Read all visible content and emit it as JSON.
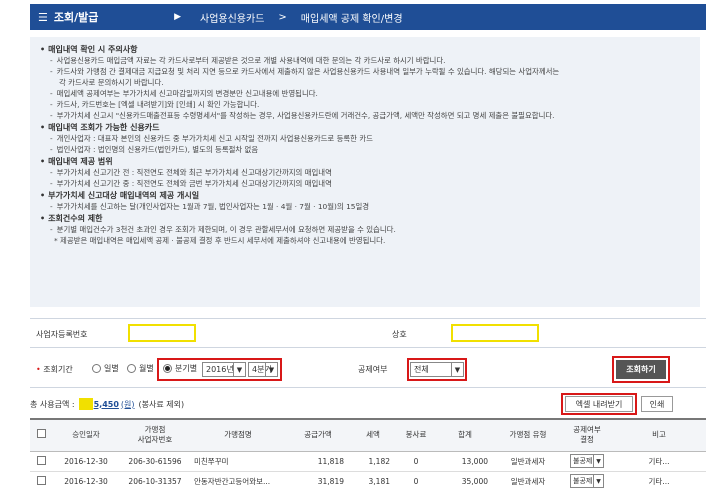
{
  "header": {
    "menu_title": "조회/발급",
    "crumbs": [
      "사업용신용카드",
      "매입세액 공제 확인/변경"
    ]
  },
  "notice": {
    "sections": [
      {
        "title": "매입내역 확인 시 주의사항",
        "items": [
          {
            "type": "it",
            "text": "사업용신용카드 매입금액 자료는 각 카드사로부터 제공받은 것으로 개별 사용내역에 대한 문의는 각 카드사로 하시기 바랍니다."
          },
          {
            "type": "it",
            "text": "카드사와 가맹점 간 결제대금 지급요청 및 처리 지연 등으로 카드사에서 제출하지 않은 사업용신용카드 사용내역 일부가 누락될 수 있습니다. 해당되는 사업자께서는"
          },
          {
            "type": "cont",
            "text": "각 카드사로 문의하시기 바랍니다."
          },
          {
            "type": "it",
            "text": "매입세액 공제여부는 부가가치세 신고마감일까지의 변경분만 신고내용에 반영됩니다."
          },
          {
            "type": "it",
            "text": "카드사, 카드번호는 [엑셀 내려받기]와 [인쇄] 시 확인 가능합니다."
          },
          {
            "type": "it",
            "text": "부가가치세 신고시 \"신용카드매출전표등 수령명세서\"를 작성하는 경우, 사업용신용카드란에 거래건수, 공급가액, 세액만 작성하면 되고 명세 제출은 불필요합니다."
          }
        ]
      },
      {
        "title": "매입내역 조회가 가능한 신용카드",
        "items": [
          {
            "type": "it",
            "text": "개인사업자 : 대표자 본인의 신용카드 중 부가가치세 신고 시작일 전까지 사업용신용카드로 등록한 카드"
          },
          {
            "type": "it",
            "text": "법인사업자 : 법인명의 신용카드(법인카드), 별도의 등록절차 없음"
          }
        ]
      },
      {
        "title": "매입내역 제공 범위",
        "items": [
          {
            "type": "it",
            "text": "부가가치세 신고기간 전 : 직전연도 전체와 최근 부가가치세 신고대상기간까지의 매입내역"
          },
          {
            "type": "it",
            "text": "부가가치세 신고기간 중 : 직전연도 전체와 금번 부가가치세 신고대상기간까지의 매입내역"
          }
        ]
      },
      {
        "title": "부가가치세 신고대상 매입내역의 제공 개시일",
        "items": [
          {
            "type": "it",
            "text": "부가가치세를 신고하는 달(개인사업자는 1월과 7월, 법인사업자는 1월 · 4월 · 7월 · 10월)의 15일경"
          }
        ]
      },
      {
        "title": "조회건수의 제한",
        "items": [
          {
            "type": "it",
            "text": "분기별 매입건수가 3천건 초과인 경우 조회가 제한되며, 이 경우 관할세무서에 요청하면 제공받을 수 있습니다."
          },
          {
            "type": "star",
            "text": "* 제공받은 매입내역은 매입세액 공제 · 불공제 결정 후 반드시 세무서에 제출하셔야 신고내용에 반영됩니다."
          }
        ]
      }
    ]
  },
  "form": {
    "biz_no_label": "사업자등록번호",
    "trade_name_label": "상호",
    "period_label": "조회기간",
    "period_options": [
      "일별",
      "월별",
      "분기별"
    ],
    "year_value": "2016년",
    "quarter_value": "4분기",
    "deduct_label": "공제여부",
    "deduct_value": "전체",
    "search_button": "조회하기",
    "excel_button": "엑셀 내려받기",
    "print_button": "인쇄"
  },
  "total": {
    "label": "총 사용금액 :",
    "amount": "5,450",
    "unit": "(원)",
    "note": "(봉사료 제외)"
  },
  "table": {
    "headers": [
      "승인일자",
      "가맹점\n사업자번호",
      "가맹점명",
      "공급가액",
      "세액",
      "봉사료",
      "합계",
      "가맹점 유형",
      "공제여부\n결정",
      "비고"
    ],
    "rows": [
      {
        "date": "2016-12-30",
        "bizno": "206-30-61596",
        "name": "미친쭈꾸미",
        "supply": "11,818",
        "tax": "1,182",
        "service": "0",
        "sum": "13,000",
        "type": "일반과세자",
        "deduct": "불공제",
        "note": "기타..."
      },
      {
        "date": "2016-12-30",
        "bizno": "206-10-31357",
        "name": "안동자반간고등어와보...",
        "supply": "31,819",
        "tax": "3,181",
        "service": "0",
        "sum": "35,000",
        "type": "일반과세자",
        "deduct": "불공제",
        "note": "기타..."
      }
    ]
  }
}
